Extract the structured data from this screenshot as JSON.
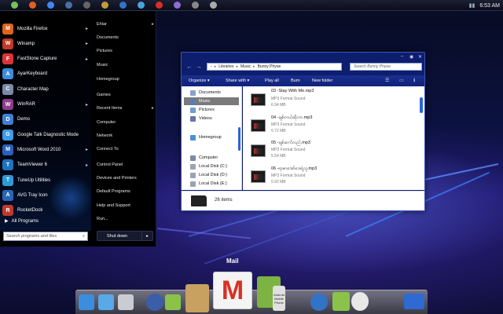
{
  "topbar": {
    "icons": [
      "android-icon",
      "firefox-icon",
      "chrome-icon",
      "network-icon",
      "terminal-icon",
      "folder-icon",
      "globe-icon",
      "sync-icon",
      "mail-icon",
      "music-icon",
      "settings-icon",
      "power-icon"
    ],
    "clock": "6:53 AM"
  },
  "start_menu": {
    "programs": [
      {
        "label": "Mozilla Firefox",
        "icon": "firefox-icon",
        "color": "#e0621b",
        "arrow": true
      },
      {
        "label": "Winamp",
        "icon": "winamp-icon",
        "color": "#c0392b",
        "arrow": true
      },
      {
        "label": "FastStone Capture",
        "icon": "faststone-icon",
        "color": "#d9343a",
        "arrow": true
      },
      {
        "label": "AyarKeyboard",
        "icon": "keyboard-icon",
        "color": "#3c8dde",
        "arrow": false
      },
      {
        "label": "Character Map",
        "icon": "character-map-icon",
        "color": "#7b8aa8",
        "arrow": false
      },
      {
        "label": "WinRAR",
        "icon": "winrar-icon",
        "color": "#8e3b8e",
        "arrow": true
      },
      {
        "label": "Demo",
        "icon": "demo-icon",
        "color": "#3f7fd8",
        "arrow": false
      },
      {
        "label": "Google Talk Diagnostic Mode",
        "icon": "google-talk-icon",
        "color": "#3d9be9",
        "arrow": false
      },
      {
        "label": "Microsoft Word 2010",
        "icon": "word-icon",
        "color": "#2b5fb8",
        "arrow": true
      },
      {
        "label": "TeamViewer 6",
        "icon": "teamviewer-icon",
        "color": "#1e73be",
        "arrow": true
      },
      {
        "label": "TuneUp Utilities",
        "icon": "tuneup-icon",
        "color": "#2f9ad8",
        "arrow": false
      },
      {
        "label": "AVG Tray Icon",
        "icon": "avg-icon",
        "color": "#2a66b2",
        "arrow": false
      },
      {
        "label": "RocketDock",
        "icon": "rocketdock-icon",
        "color": "#c0392b",
        "arrow": false
      }
    ],
    "all_programs": "All Programs",
    "search_placeholder": "Search programs and files",
    "right_items": [
      {
        "label": "Ehlar",
        "arrow": true
      },
      {
        "label": "Documents",
        "arrow": false
      },
      {
        "label": "Pictures",
        "arrow": false
      },
      {
        "label": "Music",
        "arrow": false
      },
      {
        "label": "Homegroup",
        "arrow": false
      },
      {
        "label": "Games",
        "arrow": false
      },
      {
        "label": "Recent Items",
        "arrow": true
      },
      {
        "label": "Computer",
        "arrow": false
      },
      {
        "label": "Network",
        "arrow": false
      },
      {
        "label": "Connect To",
        "arrow": false
      },
      {
        "label": "Control Panel",
        "arrow": false
      },
      {
        "label": "Devices and Printers",
        "arrow": false
      },
      {
        "label": "Default Programs",
        "arrow": false
      },
      {
        "label": "Help and Support",
        "arrow": false
      },
      {
        "label": "Run...",
        "arrow": false
      }
    ],
    "shutdown": "Shut down"
  },
  "explorer": {
    "breadcrumb": [
      "Libraries",
      "Music",
      "Bunny Phyoe"
    ],
    "search_placeholder": "Search Bunny Phyoe",
    "toolbar": [
      "Organize",
      "Share with",
      "Play all",
      "Burn",
      "New folder"
    ],
    "nav_items": [
      {
        "label": "Documents",
        "icon": "documents-icon",
        "selected": false,
        "color": "#8aa0c8"
      },
      {
        "label": "Music",
        "icon": "music-icon",
        "selected": true,
        "color": "#5d7bb8"
      },
      {
        "label": "Pictures",
        "icon": "pictures-icon",
        "selected": false,
        "color": "#6e9fcf"
      },
      {
        "label": "Videos",
        "icon": "videos-icon",
        "selected": false,
        "color": "#6276a8"
      },
      {
        "label": "Homegroup",
        "icon": "homegroup-icon",
        "selected": false,
        "color": "#4a8fd8"
      },
      {
        "label": "Computer",
        "icon": "computer-icon",
        "selected": false,
        "color": "#7d8aa3"
      },
      {
        "label": "Local Disk (C:)",
        "icon": "disk-icon",
        "selected": false,
        "color": "#9aa3b5"
      },
      {
        "label": "Local Disk (D:)",
        "icon": "disk-icon",
        "selected": false,
        "color": "#9aa3b5"
      },
      {
        "label": "Local Disk (E:)",
        "icon": "disk-icon",
        "selected": false,
        "color": "#9aa3b5"
      }
    ],
    "files": [
      {
        "name": "03 -Stay With Me.mp3",
        "type": "MP3 Format Sound",
        "size": "6.94 MB"
      },
      {
        "name": "04 -ချစ်တယ်ဆိုတာ.mp3",
        "type": "MP3 Format Sound",
        "size": "5.72 MB"
      },
      {
        "name": "05 -ချစ်ဆက်လည်.mp3",
        "type": "MP3 Format Sound",
        "size": "5.54 MB"
      },
      {
        "name": "06 -ရာဇာအော်ဒေးရဲ့သူ.mp3",
        "type": "MP3 Format Sound",
        "size": "5.92 MB"
      }
    ],
    "item_count": "26 items"
  },
  "dock": {
    "label": "Mail",
    "items": [
      {
        "icon": "phone-icon",
        "color": "#3b8de0"
      },
      {
        "icon": "sync-icon",
        "color": "#59a8e8"
      },
      {
        "icon": "trash-icon",
        "color": "#c9ccd3"
      },
      {
        "icon": "speaker-icon",
        "color": "#3a5fa8"
      },
      {
        "icon": "android-chat-icon",
        "color": "#8bc34a"
      },
      {
        "icon": "picture-frame-icon",
        "color": "#c8a060"
      },
      {
        "icon": "gmail-icon",
        "color": "#d93025"
      },
      {
        "icon": "android-icon",
        "color": "#7cb342"
      },
      {
        "icon": "android-mobile-phone-icon",
        "color": "#9e9e9e"
      },
      {
        "icon": "globe-icon",
        "color": "#3273c8"
      },
      {
        "icon": "android-market-icon",
        "color": "#8bc34a"
      },
      {
        "icon": "clock-icon",
        "color": "#e8e8e8"
      },
      {
        "icon": "screen-icon",
        "color": "#2e6ad1"
      }
    ],
    "phone_caption": "Android Mobile Phone"
  }
}
